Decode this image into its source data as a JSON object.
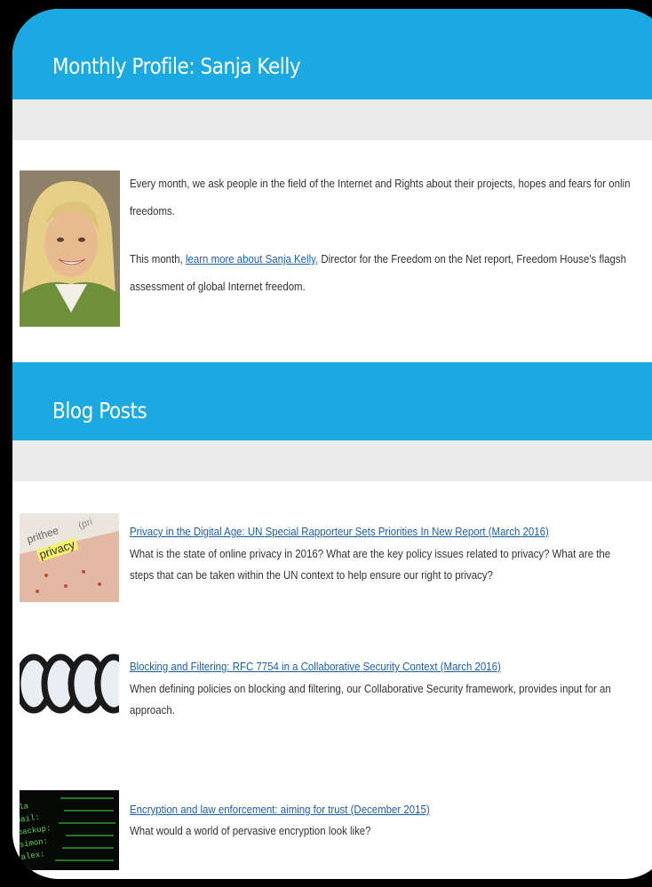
{
  "profile_section": {
    "heading": "Monthly Profile: Sanja Kelly",
    "intro_line1": "Every month, we ask people in the field of the Internet and Rights about their projects, hopes and fears for onlin",
    "intro_line2": "freedoms.",
    "this_month_prefix": "This month, ",
    "profile_link": "learn more about Sanja Kelly,",
    "this_month_suffix": " Director for the Freedom on the Net report, Freedom House's flagsh",
    "this_month_line2": "assessment of global Internet freedom."
  },
  "blog_section": {
    "heading": "Blog Posts",
    "posts": [
      {
        "title": "Privacy in the Digital Age: UN Special Rapporteur Sets Priorities In New Report (March 2016)",
        "desc_line1": "What is the state of online privacy in 2016? What are the key policy issues related to privacy? What are the",
        "desc_line2": "steps that can be taken within the UN context to help ensure our right to privacy?",
        "thumb_icon": "privacy-image"
      },
      {
        "title": "Blocking and Filtering: RFC 7754 in a Collaborative Security Context (March 2016)",
        "desc_line1": "When defining policies on blocking and filtering, our Collaborative Security framework, provides input for an",
        "desc_line2": "approach.",
        "thumb_icon": "filter-lenses-image"
      },
      {
        "title": "Encryption and law enforcement: aiming for trust (December 2015)",
        "desc_line1": "What would a world of pervasive encryption look like?",
        "thumb_icon": "terminal-code-image"
      }
    ]
  },
  "thumb_texts": {
    "privacy_words": [
      "prithee",
      "privacy",
      "(pri"
    ],
    "terminal_lines": [
      "nla",
      "mail:",
      "backup:",
      "simon:",
      "alex:"
    ]
  },
  "colors": {
    "banner": "#1ba9e1",
    "grey_bar": "#ebebeb",
    "link": "#1f5fa8",
    "text": "#333333",
    "frame_background": "#000000"
  }
}
